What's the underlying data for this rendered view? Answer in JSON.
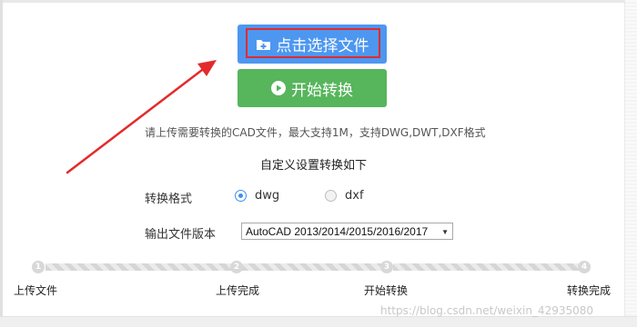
{
  "actions": {
    "select_file_label": "点击选择文件",
    "start_convert_label": "开始转换"
  },
  "hint": "请上传需要转换的CAD文件，最大支持1M，支持DWG,DWT,DXF格式",
  "settings": {
    "title": "自定义设置转换如下",
    "format_label": "转换格式",
    "format_options": [
      {
        "label": "dwg",
        "checked": true
      },
      {
        "label": "dxf",
        "checked": false
      }
    ],
    "version_label": "输出文件版本",
    "version_selected": "AutoCAD 2013/2014/2015/2016/2017"
  },
  "progress": {
    "steps": [
      {
        "number": "1",
        "label": "上传文件"
      },
      {
        "number": "2",
        "label": "上传完成"
      },
      {
        "number": "3",
        "label": "开始转换"
      },
      {
        "number": "4",
        "label": "转换完成"
      }
    ],
    "completed": 0
  },
  "watermark": "https://blog.csdn.net/weixin_42935080",
  "colors": {
    "select_button": "#4d97f0",
    "start_button": "#57b55c",
    "highlight": "#e32b2b",
    "radio_checked": "#3c8ef0"
  },
  "icons": {
    "select_button": "folder-add-icon",
    "start_button": "play-circle-icon",
    "annotation": "red-arrow-icon"
  }
}
